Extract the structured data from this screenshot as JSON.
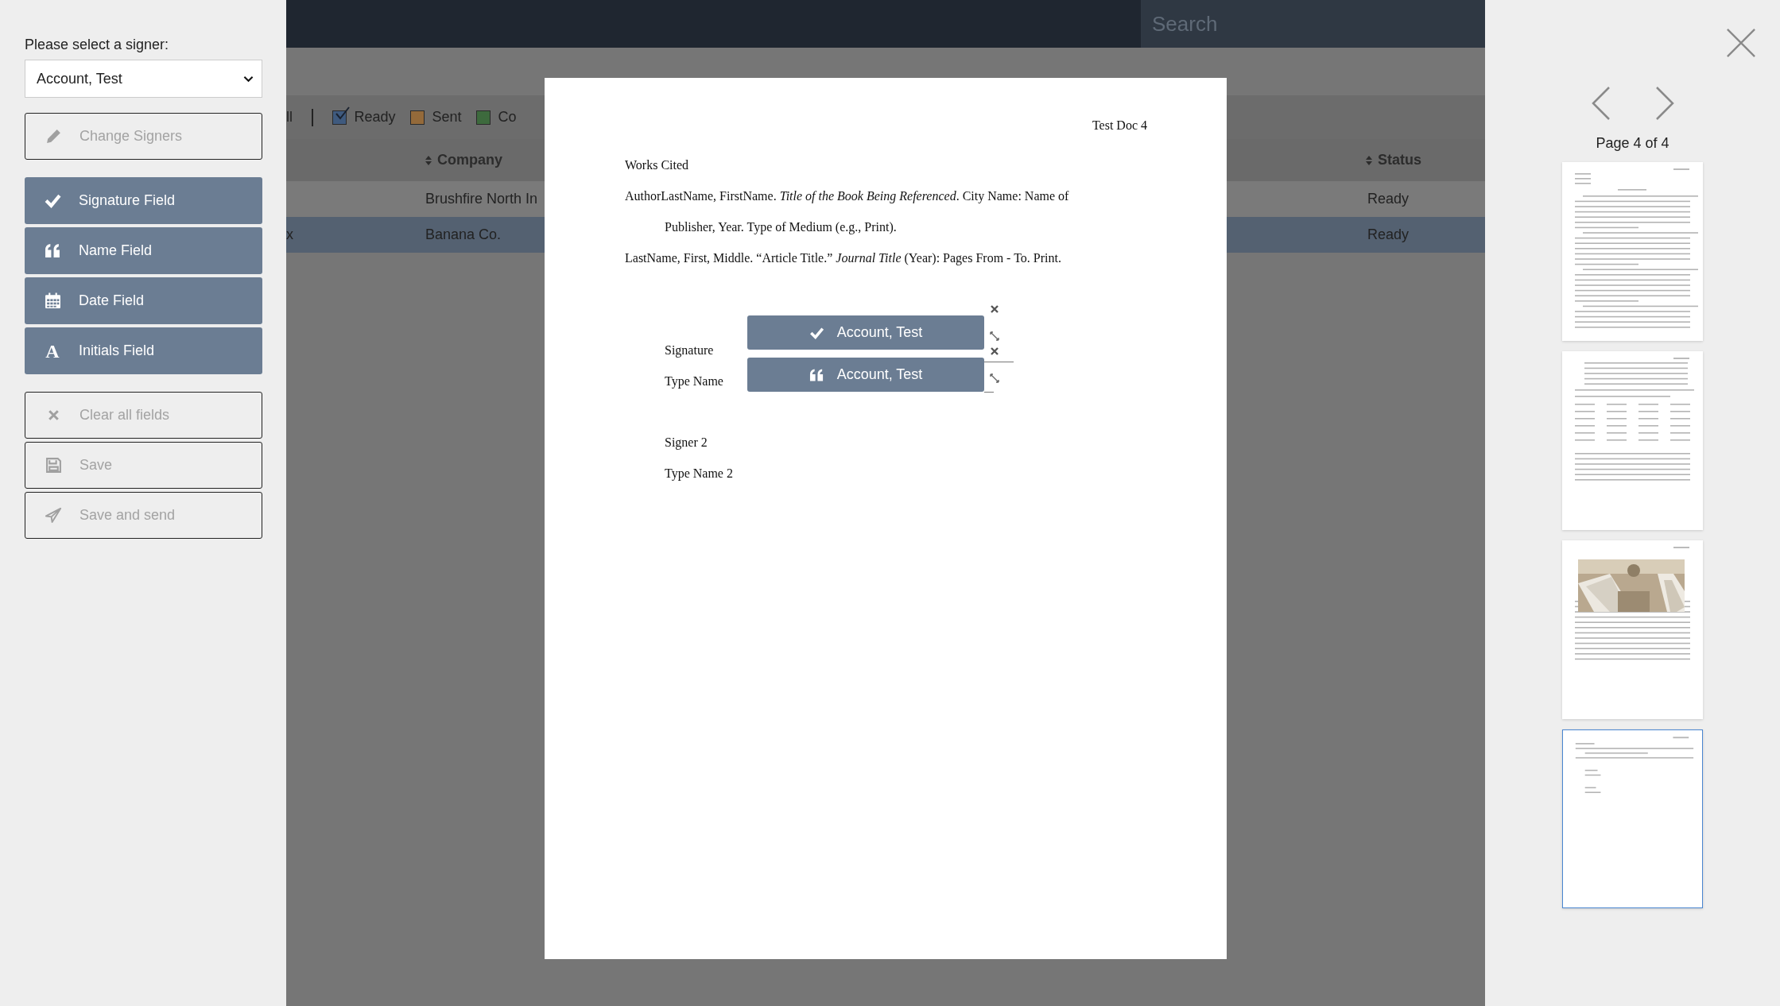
{
  "sidebar": {
    "signer_label": "Please select a signer:",
    "signer_select": {
      "value": "Account, Test"
    },
    "button_groups": [
      [
        {
          "label": "Change Signers",
          "disabled": true
        }
      ],
      [
        {
          "label": "Signature Field",
          "disabled": false
        },
        {
          "label": "Name Field",
          "disabled": false
        },
        {
          "label": "Date Field",
          "disabled": false
        },
        {
          "label": "Initials Field",
          "disabled": false,
          "icon_text": "A"
        }
      ],
      [
        {
          "label": "Clear all fields",
          "disabled": true
        },
        {
          "label": "Save",
          "disabled": true
        },
        {
          "label": "Save and send",
          "disabled": true
        }
      ]
    ]
  },
  "background": {
    "search": {
      "placeholder": "Search"
    },
    "filters": [
      {
        "label": "ll",
        "kind": "text"
      },
      {
        "kind": "divider"
      },
      {
        "label": "Ready",
        "kind": "checkbox",
        "checked": true,
        "color": "#3f5a7e"
      },
      {
        "label": "Sent",
        "kind": "checkbox",
        "checked": false,
        "color": "#946a3a"
      },
      {
        "label": "Co",
        "kind": "checkbox",
        "checked": false,
        "color": "#3d6a3d"
      }
    ],
    "table": {
      "columns": [
        {
          "label": "Company"
        },
        {
          "label": "Status"
        }
      ],
      "rows": [
        {
          "company": "Brushfire North In",
          "status": "Ready",
          "selected": false
        },
        {
          "column_1": "x",
          "company": "Banana Co.",
          "status": "Ready",
          "selected": true
        }
      ]
    }
  },
  "document": {
    "header": "Test Doc 4",
    "heading": "Works Cited",
    "entries": [
      {
        "lines": [
          "AuthorLastName, FirstName. *Title of the Book Being Referenced*. City Name: Name of",
          "Publisher, Year. Type of Medium (e.g., Print)."
        ]
      },
      {
        "lines": [
          "LastName, First, Middle. “Article Title.” *Journal Title* (Year): Pages From - To. Print."
        ]
      }
    ],
    "signature_rows": [
      {
        "label": "Signature",
        "line": true,
        "field": {
          "kind": "signature",
          "signer": "Account, Test"
        }
      },
      {
        "label": "Type Name",
        "line": true,
        "field": {
          "kind": "name",
          "signer": "Account, Test"
        }
      },
      {
        "label": "Signer 2",
        "line": false
      },
      {
        "label": "Type Name 2",
        "line": false
      }
    ]
  },
  "viewer": {
    "page_label": "Page 4 of 4",
    "thumbnails": [
      {
        "kind": "text",
        "selected": false
      },
      {
        "kind": "table",
        "selected": false
      },
      {
        "kind": "picture",
        "selected": false
      },
      {
        "kind": "form",
        "selected": true
      }
    ]
  }
}
